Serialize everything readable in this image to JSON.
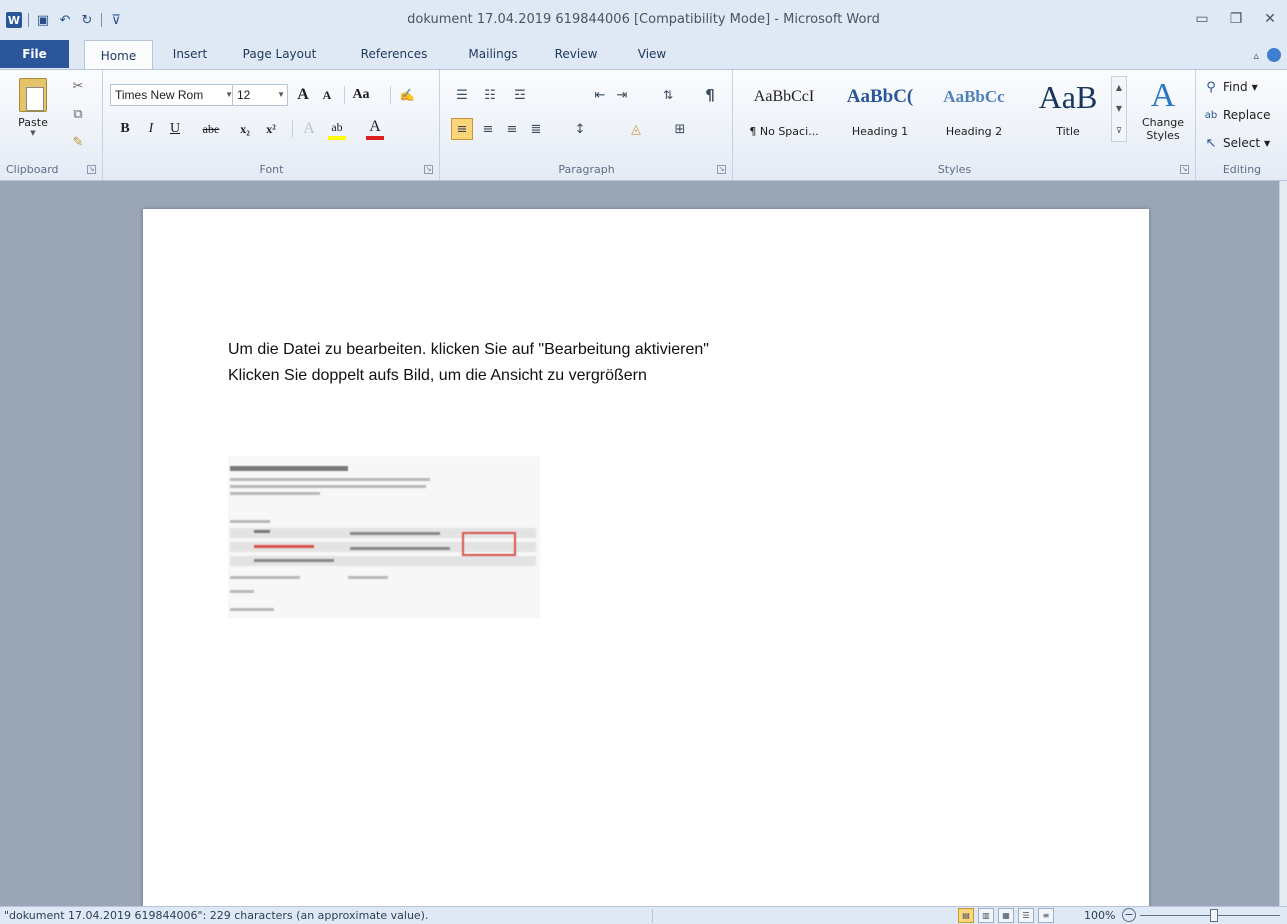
{
  "window": {
    "title": "dokument 17.04.2019 619844006 [Compatibility Mode]  -  Microsoft Word",
    "app_logo": "W"
  },
  "tabs": [
    "File",
    "Home",
    "Insert",
    "Page Layout",
    "References",
    "Mailings",
    "Review",
    "View"
  ],
  "clipboard": {
    "paste_label": "Paste",
    "group_label": "Clipboard"
  },
  "font": {
    "family": "Times New Rom",
    "size": "12",
    "grow": "A",
    "shrink": "A",
    "case": "Aa",
    "bold": "B",
    "italic": "I",
    "underline": "U",
    "strike": "abe",
    "subscript": "x₂",
    "superscript": "x²",
    "highlight": "ab",
    "font_color": "A",
    "group_label": "Font"
  },
  "paragraph": {
    "group_label": "Paragraph",
    "pilcrow": "¶"
  },
  "styles": {
    "items": [
      {
        "preview": "AaBbCcI",
        "name": "¶ No Spaci..."
      },
      {
        "preview": "AaBbC(",
        "name": "Heading 1"
      },
      {
        "preview": "AaBbCc",
        "name": "Heading 2"
      },
      {
        "preview": "AaB",
        "name": "Title"
      }
    ],
    "change_line1": "Change",
    "change_line2": "Styles",
    "group_label": "Styles"
  },
  "editing": {
    "find": "Find",
    "replace": "Replace",
    "select": "Select",
    "group_label": "Editing"
  },
  "document": {
    "line1": "Um  die Datei zu bearbeiten. klicken Sie auf \"Bearbeitung aktivieren\"",
    "line2": "Klicken Sie doppelt aufs Bild, um  die Ansicht zu vergrößern"
  },
  "status": {
    "text": "\"dokument 17.04.2019 619844006\": 229 characters (an approximate value).",
    "zoom": "100%"
  },
  "colors": {
    "file_tab": "#2b579a",
    "ribbon_bg": "#fbfcfe",
    "workspace_bg": "#9aa6b6",
    "active_highlight": "#fbd57a"
  }
}
